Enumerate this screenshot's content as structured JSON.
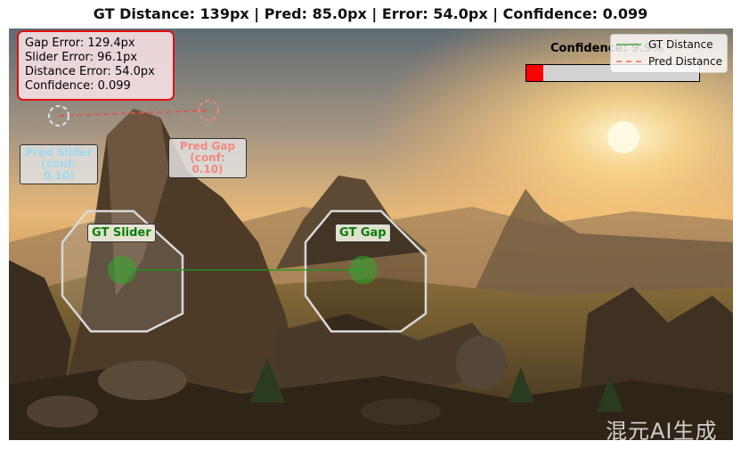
{
  "title": "GT Distance: 139px | Pred: 85.0px | Error: 54.0px | Confidence: 0.099",
  "stats": {
    "gap_error": "Gap Error: 129.4px",
    "slider_error": "Slider Error: 96.1px",
    "distance_error": "Distance Error: 54.0px",
    "confidence": "Confidence: 0.099"
  },
  "labels": {
    "pred_slider": "Pred Slider\n(conf: 0.10)",
    "pred_gap": "Pred Gap\n(conf: 0.10)",
    "gt_slider": "GT Slider",
    "gt_gap": "GT Gap"
  },
  "confidence_meter": {
    "label": "Confidence: 9.9%",
    "value": 0.099,
    "fill_color": "#ff0000",
    "track_color": "#d3d3d3"
  },
  "legend": {
    "gt_distance": "GT Distance",
    "pred_distance": "Pred Distance",
    "gt_color": "#6db36d",
    "pred_color": "#f08a80"
  },
  "watermark": "混元AI生成"
}
